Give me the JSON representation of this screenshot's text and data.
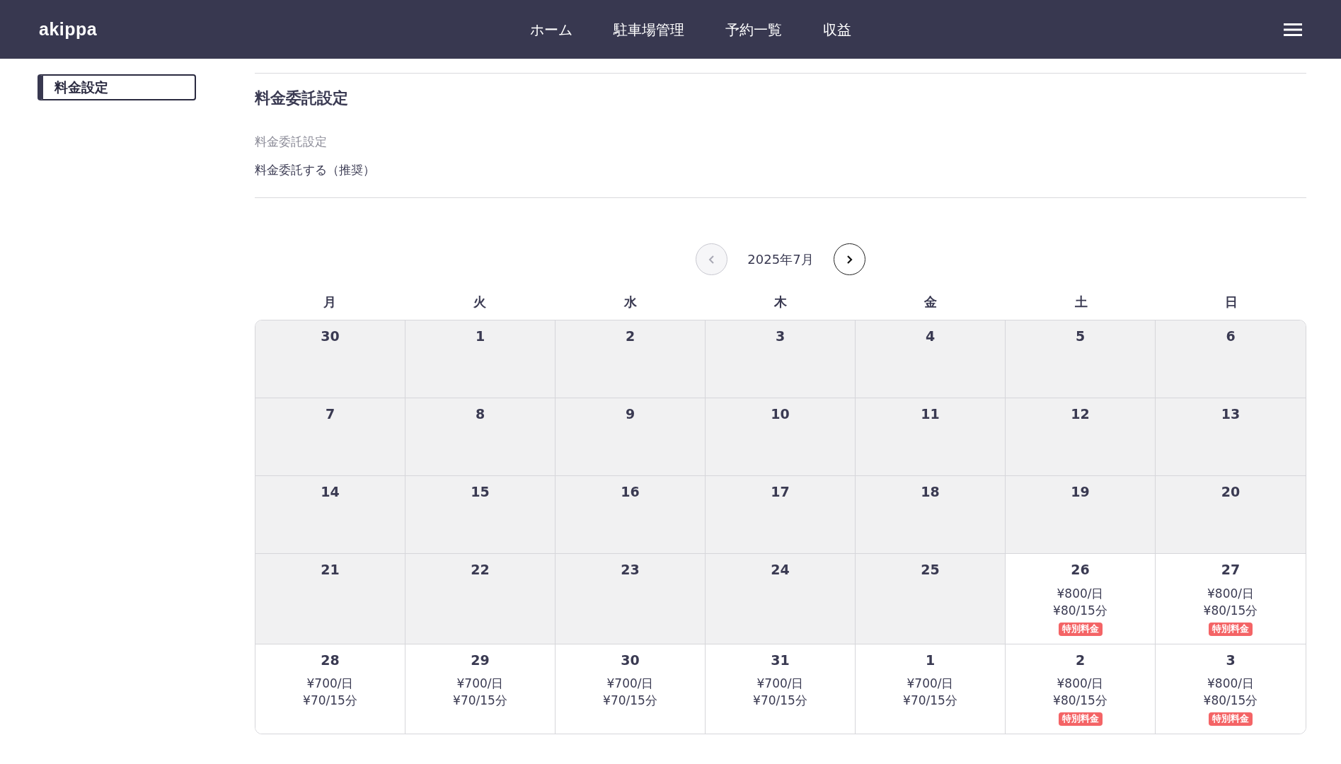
{
  "header": {
    "brand": "akippa",
    "nav": [
      {
        "label": "ホーム"
      },
      {
        "label": "駐車場管理"
      },
      {
        "label": "予約一覧"
      },
      {
        "label": "収益"
      }
    ]
  },
  "sidebar": {
    "items": [
      {
        "label": "料金設定",
        "selected": true
      }
    ]
  },
  "section": {
    "title": "料金委託設定",
    "field_label": "料金委託設定",
    "field_value": "料金委託する（推奨）"
  },
  "calendar": {
    "month": "2025年7月",
    "prev_disabled": true,
    "next_disabled": false,
    "weekdays": [
      "月",
      "火",
      "水",
      "木",
      "金",
      "土",
      "日"
    ],
    "days": [
      {
        "day": "30",
        "disabled": true
      },
      {
        "day": "1",
        "disabled": true
      },
      {
        "day": "2",
        "disabled": true
      },
      {
        "day": "3",
        "disabled": true
      },
      {
        "day": "4",
        "disabled": true
      },
      {
        "day": "5",
        "disabled": true
      },
      {
        "day": "6",
        "disabled": true
      },
      {
        "day": "7",
        "disabled": true
      },
      {
        "day": "8",
        "disabled": true
      },
      {
        "day": "9",
        "disabled": true
      },
      {
        "day": "10",
        "disabled": true
      },
      {
        "day": "11",
        "disabled": true
      },
      {
        "day": "12",
        "disabled": true
      },
      {
        "day": "13",
        "disabled": true
      },
      {
        "day": "14",
        "disabled": true
      },
      {
        "day": "15",
        "disabled": true
      },
      {
        "day": "16",
        "disabled": true
      },
      {
        "day": "17",
        "disabled": true
      },
      {
        "day": "18",
        "disabled": true
      },
      {
        "day": "19",
        "disabled": true
      },
      {
        "day": "20",
        "disabled": true
      },
      {
        "day": "21",
        "disabled": true
      },
      {
        "day": "22",
        "disabled": true
      },
      {
        "day": "23",
        "disabled": true
      },
      {
        "day": "24",
        "disabled": true
      },
      {
        "day": "25",
        "disabled": true
      },
      {
        "day": "26",
        "disabled": false,
        "prices": [
          "¥800/日",
          "¥80/15分"
        ],
        "badge": "特別料金"
      },
      {
        "day": "27",
        "disabled": false,
        "prices": [
          "¥800/日",
          "¥80/15分"
        ],
        "badge": "特別料金"
      },
      {
        "day": "28",
        "disabled": false,
        "prices": [
          "¥700/日",
          "¥70/15分"
        ]
      },
      {
        "day": "29",
        "disabled": false,
        "prices": [
          "¥700/日",
          "¥70/15分"
        ]
      },
      {
        "day": "30",
        "disabled": false,
        "prices": [
          "¥700/日",
          "¥70/15分"
        ]
      },
      {
        "day": "31",
        "disabled": false,
        "prices": [
          "¥700/日",
          "¥70/15分"
        ]
      },
      {
        "day": "1",
        "disabled": false,
        "prices": [
          "¥700/日",
          "¥70/15分"
        ]
      },
      {
        "day": "2",
        "disabled": false,
        "prices": [
          "¥800/日",
          "¥80/15分"
        ],
        "badge": "特別料金"
      },
      {
        "day": "3",
        "disabled": false,
        "prices": [
          "¥800/日",
          "¥80/15分"
        ],
        "badge": "特別料金"
      }
    ]
  }
}
